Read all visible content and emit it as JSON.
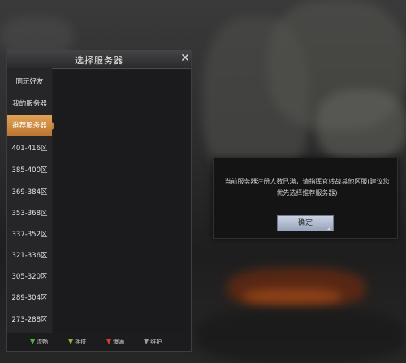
{
  "panel": {
    "title": "选择服务器",
    "close_symbol": "✕",
    "tabs": [
      {
        "label": "同玩好友",
        "active": false
      },
      {
        "label": "我的服务器",
        "active": false
      },
      {
        "label": "推荐服务器",
        "active": true
      },
      {
        "label": "401-416区",
        "active": false
      },
      {
        "label": "385-400区",
        "active": false
      },
      {
        "label": "369-384区",
        "active": false
      },
      {
        "label": "353-368区",
        "active": false
      },
      {
        "label": "337-352区",
        "active": false
      },
      {
        "label": "321-336区",
        "active": false
      },
      {
        "label": "305-320区",
        "active": false
      },
      {
        "label": "289-304区",
        "active": false
      },
      {
        "label": "273-288区",
        "active": false
      }
    ],
    "legend": [
      {
        "label": "流畅",
        "icon": "signal-icon",
        "color": "#4fb83f"
      },
      {
        "label": "拥挤",
        "icon": "signal-icon",
        "color": "#8ab43a"
      },
      {
        "label": "爆满",
        "icon": "signal-icon",
        "color": "#d63a2f"
      },
      {
        "label": "维护",
        "icon": "signal-icon",
        "color": "#9a9a9a"
      }
    ]
  },
  "dialog": {
    "message": "当前服务器注册人数已满，请指挥官转战其他区服(建议您优先选择推荐服务器)",
    "confirm_label": "确定"
  },
  "colors": {
    "accent_tab": "#d08c40",
    "panel_bg": "#1e1e21",
    "dialog_bg": "#141415"
  }
}
